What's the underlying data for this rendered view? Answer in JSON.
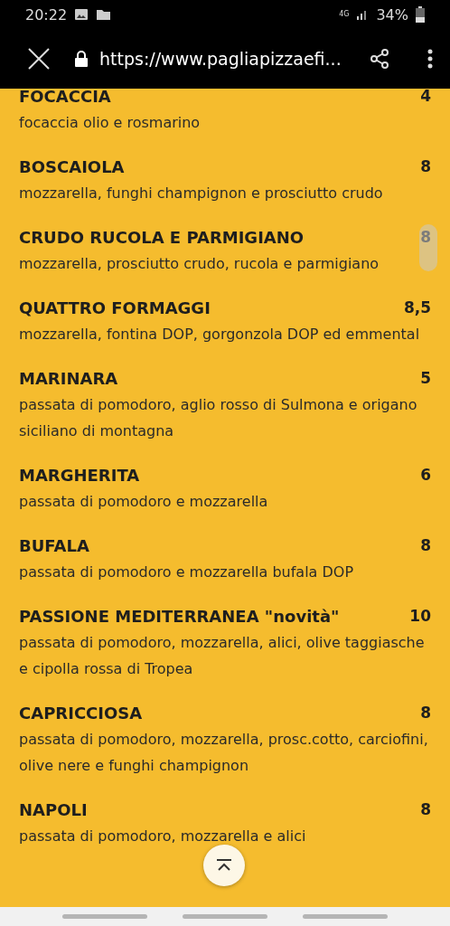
{
  "status_bar": {
    "time": "20:22",
    "network": "4G",
    "battery": "34%"
  },
  "browser": {
    "url": "https://www.pagliapizzaefi..."
  },
  "menu": [
    {
      "name": "FOCACCIA",
      "price": "4",
      "description": "focaccia olio e rosmarino"
    },
    {
      "name": "BOSCAIOLA",
      "price": "8",
      "description": "mozzarella, funghi champignon e prosciutto crudo"
    },
    {
      "name": "CRUDO RUCOLA E PARMIGIANO",
      "price": "8",
      "description": "mozzarella, prosciutto crudo, rucola e parmigiano"
    },
    {
      "name": "QUATTRO FORMAGGI",
      "price": "8,5",
      "description": "mozzarella, fontina DOP, gorgonzola DOP ed emmental"
    },
    {
      "name": "MARINARA",
      "price": "5",
      "description": "passata di pomodoro, aglio rosso di Sulmona e origano siciliano di montagna"
    },
    {
      "name": "MARGHERITA",
      "price": "6",
      "description": "passata di pomodoro e mozzarella"
    },
    {
      "name": "BUFALA",
      "price": "8",
      "description": "passata di pomodoro e mozzarella bufala DOP"
    },
    {
      "name": "PASSIONE MEDITERRANEA \"novità\"",
      "price": "10",
      "description": "passata di pomodoro, mozzarella, alici, olive taggiasche e cipolla rossa di Tropea"
    },
    {
      "name": "CAPRICCIOSA",
      "price": "8",
      "description": "passata di pomodoro, mozzarella, prosc.cotto, carciofini, olive nere e funghi champignon"
    },
    {
      "name": "NAPOLI",
      "price": "8",
      "description": "passata di pomodoro, mozzarella e alici"
    }
  ]
}
